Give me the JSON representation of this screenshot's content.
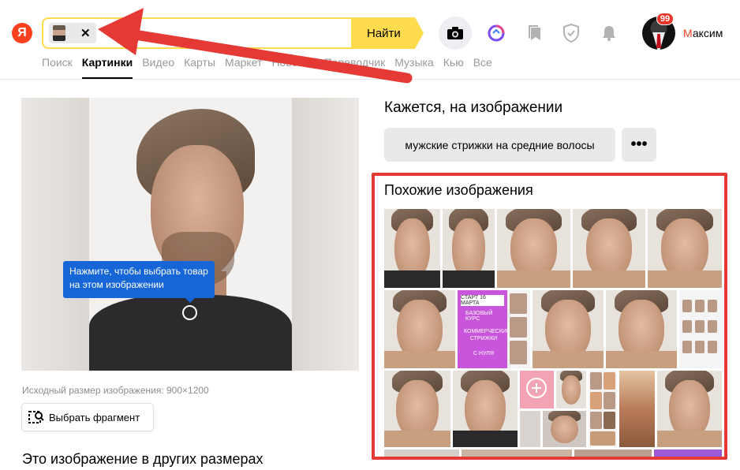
{
  "header": {
    "logo": "Я",
    "search_button": "Найти",
    "chip_close": "✕",
    "notifications_count": "99",
    "user_first_letter": "М",
    "user_rest": "аксим",
    "icons": [
      "camera-icon",
      "alice-icon",
      "collections-icon",
      "protect-icon",
      "bell-icon"
    ]
  },
  "tabs": [
    {
      "label": "Поиск",
      "active": false
    },
    {
      "label": "Картинки",
      "active": true
    },
    {
      "label": "Видео",
      "active": false
    },
    {
      "label": "Карты",
      "active": false
    },
    {
      "label": "Маркет",
      "active": false
    },
    {
      "label": "Новости",
      "active": false
    },
    {
      "label": "Переводчик",
      "active": false
    },
    {
      "label": "Музыка",
      "active": false
    },
    {
      "label": "Кью",
      "active": false
    },
    {
      "label": "Все",
      "active": false
    }
  ],
  "image_panel": {
    "tooltip": "Нажмите, чтобы выбрать товар на этом изображении",
    "original_size": "Исходный размер изображения: 900×1200",
    "fragment_button": "Выбрать фрагмент",
    "other_sizes": "Это изображение в других размерах"
  },
  "right": {
    "seems_title": "Кажется, на изображении",
    "tag": "мужские стрижки на средние волосы",
    "more": "•••",
    "similar_title": "Похожие изображения",
    "promo": {
      "date": "СТАРТ 16 МАРТА",
      "course": "БАЗОВЫЙ КУРС",
      "name": "КОММЕРЧЕСКИЕ СТРИЖКИ",
      "note": "С НУЛЯ"
    }
  },
  "colors": {
    "accent_yellow": "#ffdb4d",
    "logo_red": "#fc3f1d",
    "tooltip_blue": "#1766d8",
    "highlight_red": "#e53935",
    "arrow_red": "#e53935"
  }
}
